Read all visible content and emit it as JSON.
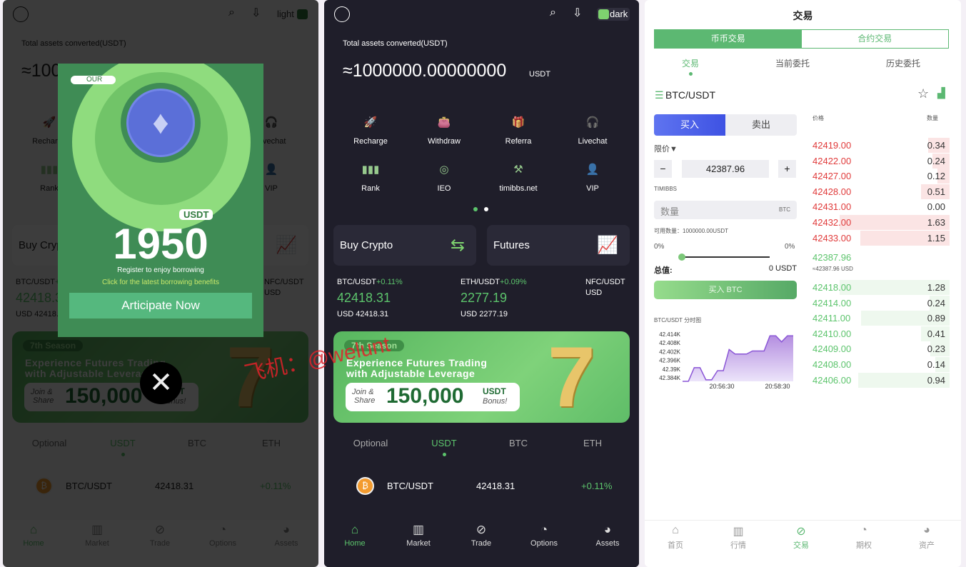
{
  "home": {
    "total_label": "Total assets converted(USDT)",
    "total_value": "≈1000000.00000000",
    "total_unit": "USDT",
    "themes": {
      "light": "light",
      "dark": "dark"
    },
    "shortcuts": [
      {
        "label": "Recharge",
        "icon": "rocket-icon"
      },
      {
        "label": "Withdraw",
        "icon": "wallet-icon"
      },
      {
        "label": "Referra",
        "icon": "gift-icon"
      },
      {
        "label": "Livechat",
        "icon": "headset-icon"
      },
      {
        "label": "Rank",
        "icon": "rank-icon"
      },
      {
        "label": "IEO",
        "icon": "ieo-icon"
      },
      {
        "label": "timibbs.net",
        "icon": "hammer-icon"
      },
      {
        "label": "VIP",
        "icon": "vip-icon"
      }
    ],
    "cards": [
      {
        "label": "Buy Crypto",
        "icon": "exchange-coins-icon"
      },
      {
        "label": "Futures",
        "icon": "growth-chart-icon"
      }
    ],
    "tickers": [
      {
        "pair": "BTC/USDT",
        "change": "+0.11%",
        "price": "42418.31",
        "usd": "USD 42418.31"
      },
      {
        "pair": "ETH/USDT",
        "change": "+0.09%",
        "price": "2277.19",
        "usd": "USD 2277.19"
      },
      {
        "pair": "NFC/USDT",
        "change": "",
        "price": "",
        "usd": "USD"
      }
    ],
    "banner": {
      "season": "7th Season",
      "line1": "Experience Futures Trading",
      "line2": "with Adjustable Leverage",
      "join": "Join &",
      "share": "Share",
      "amount": "150,000",
      "unit": "USDT",
      "bonus": "Bonus!",
      "big": "7"
    },
    "tabs": [
      "Optional",
      "USDT",
      "BTC",
      "ETH"
    ],
    "active_tab": 1,
    "list": [
      {
        "pair": "BTC/USDT",
        "price": "42418.31",
        "change": "+0.11%"
      }
    ],
    "nav": [
      {
        "label": "Home",
        "icon": "home-icon"
      },
      {
        "label": "Market",
        "icon": "market-icon"
      },
      {
        "label": "Trade",
        "icon": "trade-icon"
      },
      {
        "label": "Options",
        "icon": "options-icon"
      },
      {
        "label": "Assets",
        "icon": "assets-icon"
      }
    ]
  },
  "popup": {
    "badge": "OUR",
    "unit": "USDT",
    "amount": "1950",
    "line1": "Register to enjoy borrowing",
    "line2": "Click for the latest borrowing benefits",
    "button": "Articipate Now"
  },
  "watermark": "飞机：@welunt",
  "trade": {
    "title": "交易",
    "segments": [
      "币币交易",
      "合约交易"
    ],
    "subtabs": [
      "交易",
      "当前委托",
      "历史委托"
    ],
    "pair": "BTC/USDT",
    "buy": "买入",
    "sell": "卖出",
    "order_type": "限价▼",
    "price": "42387.96",
    "minus": "−",
    "plus": "+",
    "field_label": "TIMIBBS",
    "qty_placeholder": "数量",
    "qty_unit": "BTC",
    "available": "可用数量：1000000.00USDT",
    "pct_left": "0%",
    "pct_right": "0%",
    "slider_value": 0,
    "total_label": "总值:",
    "total_value": "0 USDT",
    "buy_button": "买入 BTC",
    "chart_title": "BTC/USDT 分时图",
    "book_headers": {
      "price": "价格",
      "qty": "数量"
    },
    "asks": [
      [
        "42419.00",
        "0.34"
      ],
      [
        "42422.00",
        "0.24"
      ],
      [
        "42427.00",
        "0.12"
      ],
      [
        "42428.00",
        "0.51"
      ],
      [
        "42431.00",
        "0.00"
      ],
      [
        "42432.00",
        "1.63"
      ],
      [
        "42433.00",
        "1.15"
      ]
    ],
    "mid": "42387.96",
    "mid_usd": "≈42387.96 USD",
    "bids": [
      [
        "42418.00",
        "1.28"
      ],
      [
        "42414.00",
        "0.24"
      ],
      [
        "42411.00",
        "0.89"
      ],
      [
        "42410.00",
        "0.41"
      ],
      [
        "42409.00",
        "0.23"
      ],
      [
        "42408.00",
        "0.14"
      ],
      [
        "42406.00",
        "0.94"
      ]
    ],
    "nav": [
      {
        "label": "首页",
        "icon": "home-icon"
      },
      {
        "label": "行情",
        "icon": "market-icon"
      },
      {
        "label": "交易",
        "icon": "trade-icon"
      },
      {
        "label": "期权",
        "icon": "options-icon"
      },
      {
        "label": "资产",
        "icon": "assets-icon"
      }
    ],
    "nav_active": 2,
    "colors": {
      "green": "#5cc46c",
      "red": "#e03a3a",
      "blue": "#4a5ee8"
    }
  },
  "chart_data": {
    "type": "area",
    "y_ticks": [
      "42.414K",
      "42.408K",
      "42.402K",
      "42.396K",
      "42.39K",
      "42.384K"
    ],
    "x_ticks": [
      "20:56:30",
      "20:58:30"
    ],
    "ylim": [
      42384,
      42416
    ],
    "values": [
      42384,
      42384,
      42393,
      42393,
      42385,
      42385,
      42391,
      42391,
      42405,
      42402,
      42402,
      42402,
      42404,
      42404,
      42404,
      42414,
      42414,
      42410,
      42414,
      42414
    ]
  }
}
